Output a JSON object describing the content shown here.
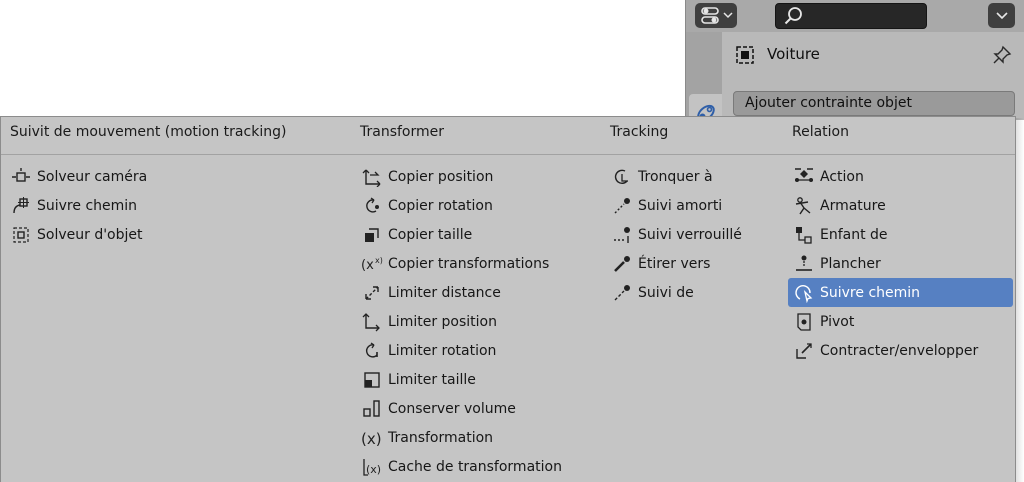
{
  "properties": {
    "object_name": "Voiture",
    "add_constraint_label": "Ajouter contrainte objet",
    "search_value": ""
  },
  "menu": {
    "columns": [
      {
        "header": "Suivit de mouvement (motion tracking)",
        "items": [
          {
            "label": "Solveur caméra",
            "icon": "camera-solver-icon"
          },
          {
            "label": "Suivre chemin",
            "icon": "follow-track-icon"
          },
          {
            "label": "Solveur d'objet",
            "icon": "object-solver-icon"
          }
        ]
      },
      {
        "header": "Transformer",
        "items": [
          {
            "label": "Copier position",
            "icon": "copy-location-icon"
          },
          {
            "label": "Copier rotation",
            "icon": "copy-rotation-icon"
          },
          {
            "label": "Copier taille",
            "icon": "copy-scale-icon"
          },
          {
            "label": "Copier transformations",
            "icon": "copy-transforms-icon"
          },
          {
            "label": "Limiter distance",
            "icon": "limit-distance-icon"
          },
          {
            "label": "Limiter position",
            "icon": "limit-location-icon"
          },
          {
            "label": "Limiter rotation",
            "icon": "limit-rotation-icon"
          },
          {
            "label": "Limiter taille",
            "icon": "limit-scale-icon"
          },
          {
            "label": "Conserver volume",
            "icon": "maintain-volume-icon"
          },
          {
            "label": "Transformation",
            "icon": "transformation-icon"
          },
          {
            "label": "Cache de transformation",
            "icon": "transform-cache-icon"
          }
        ]
      },
      {
        "header": "Tracking",
        "items": [
          {
            "label": "Tronquer à",
            "icon": "clamp-to-icon"
          },
          {
            "label": "Suivi amorti",
            "icon": "damped-track-icon"
          },
          {
            "label": "Suivi verrouillé",
            "icon": "locked-track-icon"
          },
          {
            "label": "Étirer vers",
            "icon": "stretch-to-icon"
          },
          {
            "label": "Suivi de",
            "icon": "track-to-icon"
          }
        ]
      },
      {
        "header": "Relation",
        "items": [
          {
            "label": "Action",
            "icon": "action-icon"
          },
          {
            "label": "Armature",
            "icon": "armature-icon"
          },
          {
            "label": "Enfant de",
            "icon": "child-of-icon"
          },
          {
            "label": "Plancher",
            "icon": "floor-icon"
          },
          {
            "label": "Suivre chemin",
            "icon": "follow-path-icon",
            "active": true
          },
          {
            "label": "Pivot",
            "icon": "pivot-icon"
          },
          {
            "label": "Contracter/envelopper",
            "icon": "shrinkwrap-icon"
          }
        ]
      }
    ]
  },
  "colors": {
    "highlight": "#5680c2",
    "menu_bg": "#c5c5c5",
    "panel_bg": "#b9b9b9"
  }
}
